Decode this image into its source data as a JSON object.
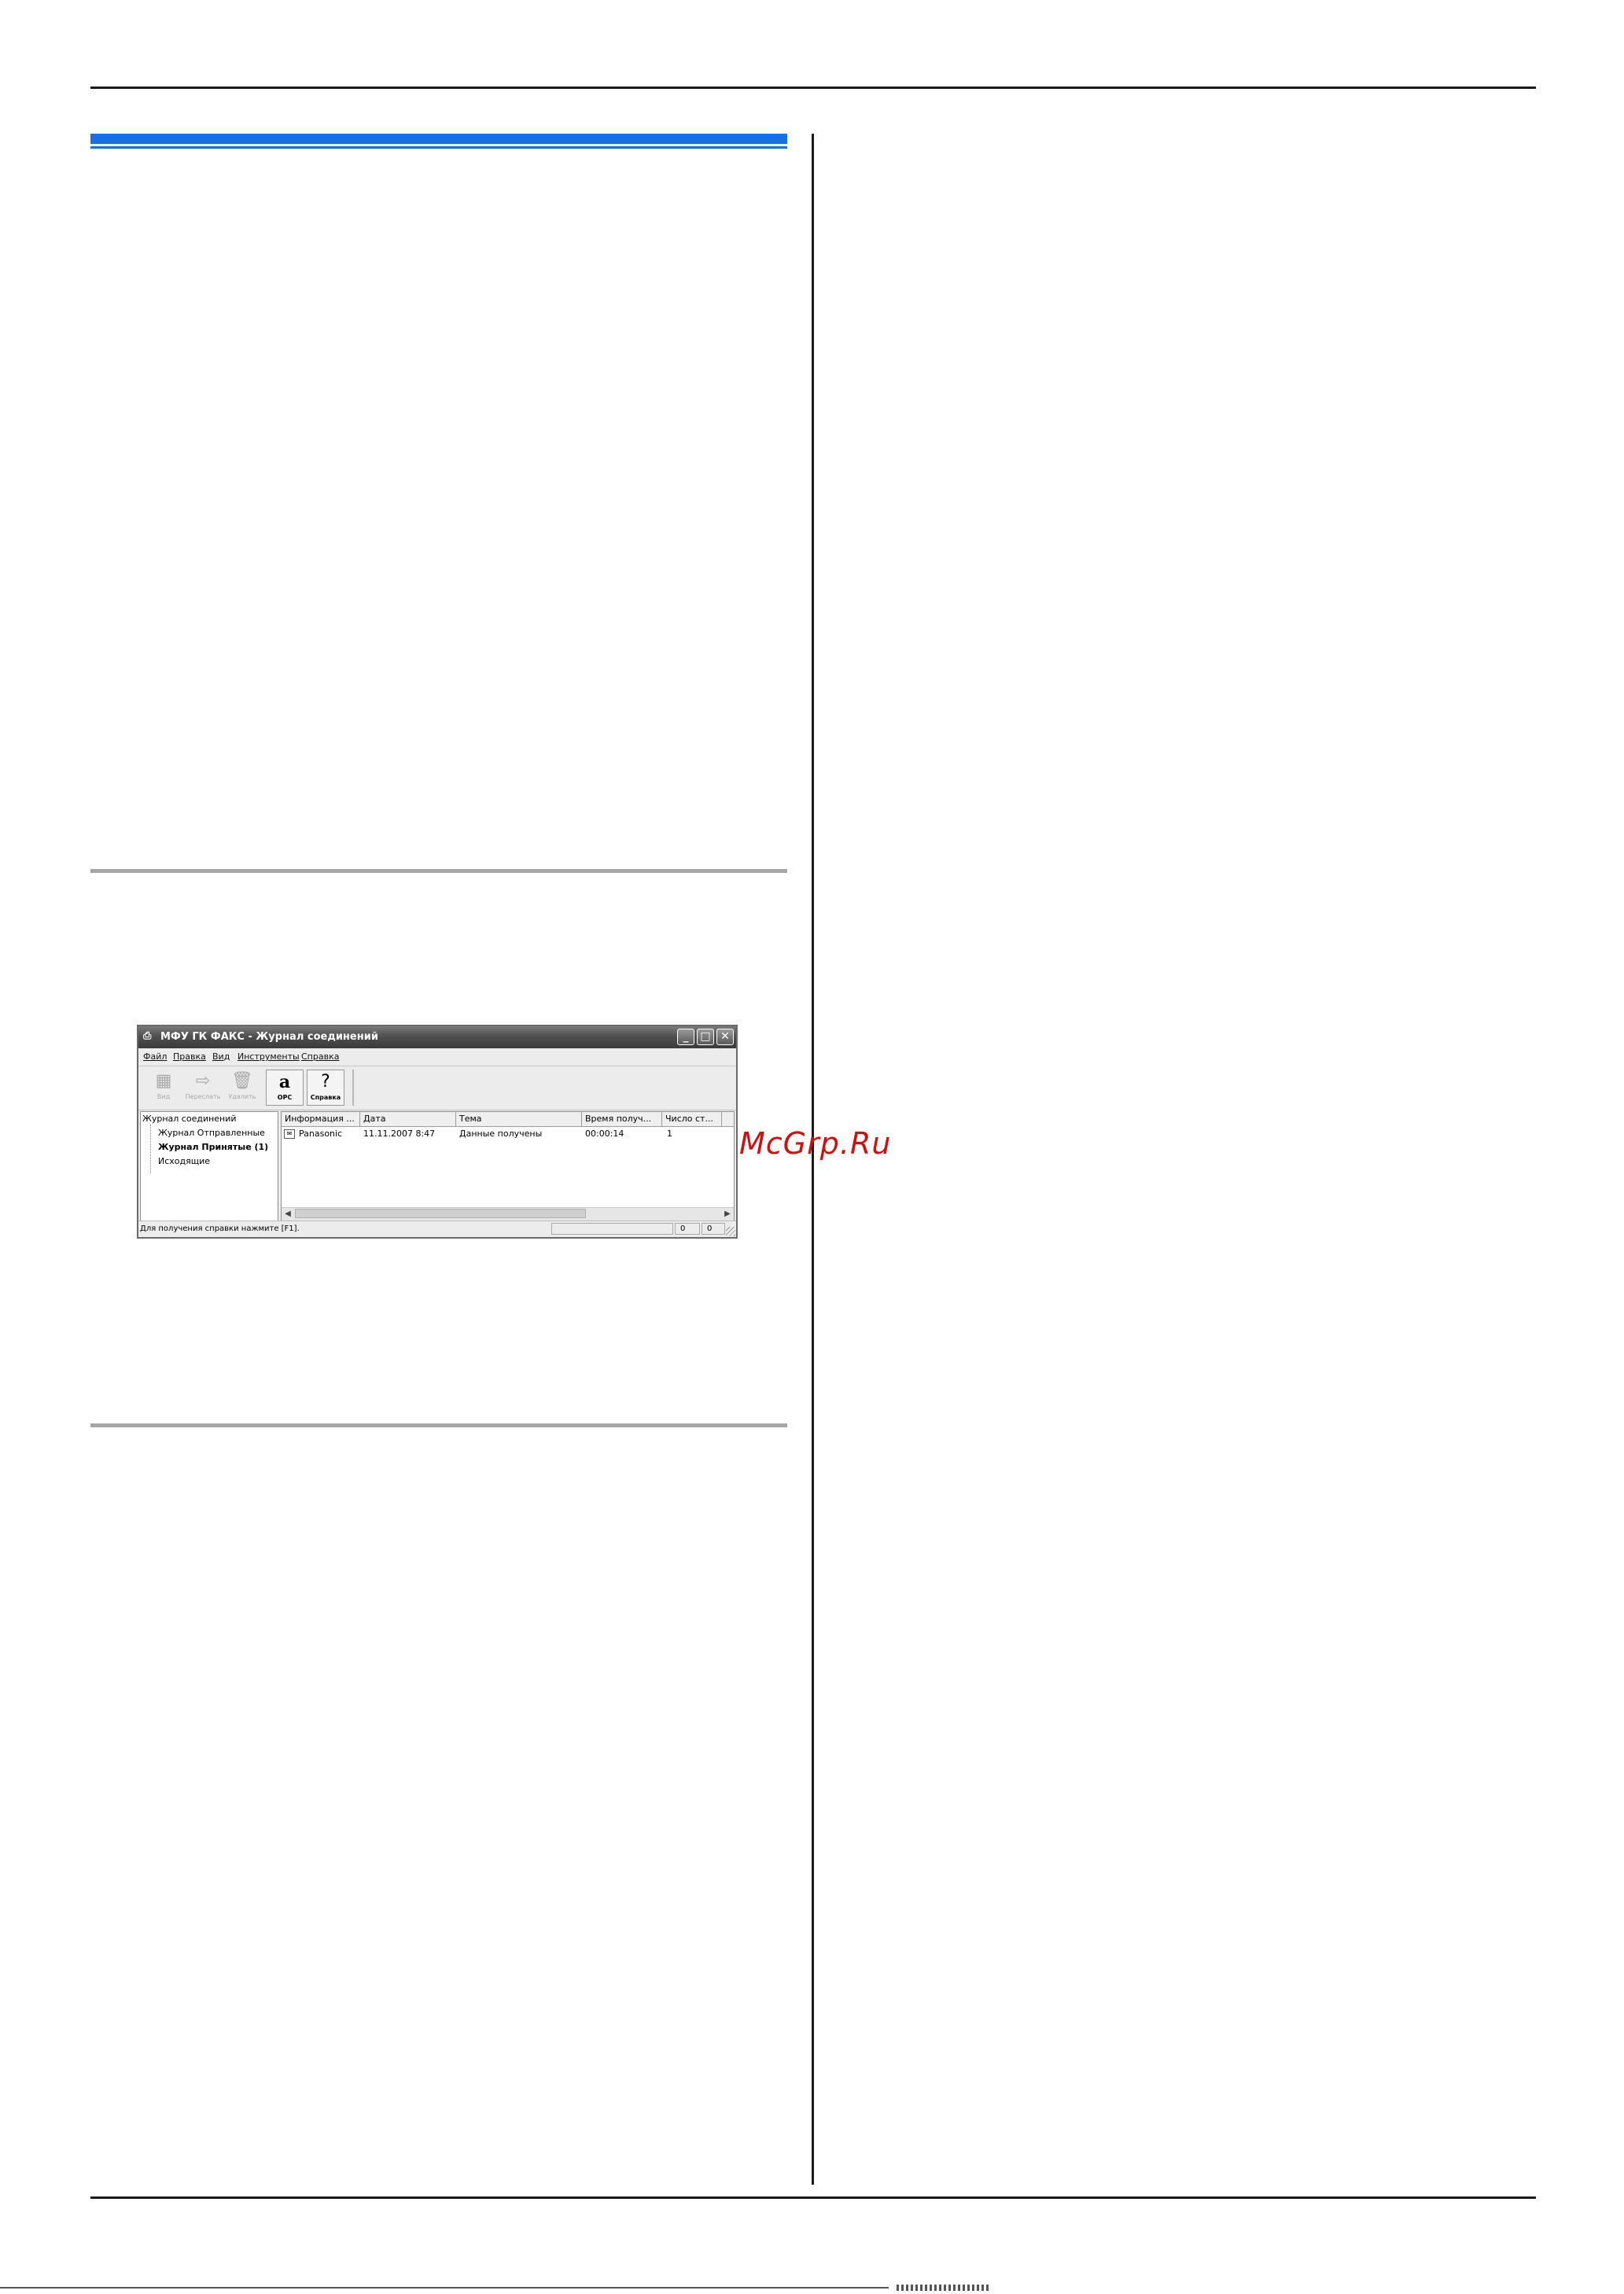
{
  "watermark": "McGrp.Ru",
  "window": {
    "title": "МФУ ГК ФАКС - Журнал соединений",
    "title_icon": "printer-icon",
    "controls": [
      "minimize-icon",
      "maximize-icon",
      "close-icon"
    ],
    "menu": [
      "Файл",
      "Правка",
      "Вид",
      "Инструменты",
      "Справка"
    ],
    "toolbar": {
      "buttons": [
        {
          "label": "Вид",
          "icon": "view-icon",
          "enabled": false
        },
        {
          "label": "Переслать",
          "icon": "forward-icon",
          "enabled": false
        },
        {
          "label": "Удалить",
          "icon": "delete-icon",
          "enabled": false
        },
        {
          "label": "OPC",
          "icon": "ocr-icon",
          "enabled": true
        },
        {
          "label": "Справка",
          "icon": "help-icon",
          "enabled": true
        }
      ]
    },
    "tree": {
      "root": "Журнал соединений",
      "items": [
        "Журнал Отправленные",
        "Журнал Принятые (1)",
        "Исходящие"
      ],
      "selected": "Журнал Принятые (1)"
    },
    "list": {
      "columns": [
        "Информация ...",
        "Дата",
        "Тема",
        "Время получ...",
        "Число ст..."
      ],
      "rows": [
        [
          "Panasonic",
          "11.11.2007 8:47",
          "Данные получены",
          "00:00:14",
          "1"
        ]
      ]
    },
    "status": {
      "text": "Для получения справки нажмите [F1].",
      "pane_2": "0",
      "pane_3": "0"
    }
  }
}
